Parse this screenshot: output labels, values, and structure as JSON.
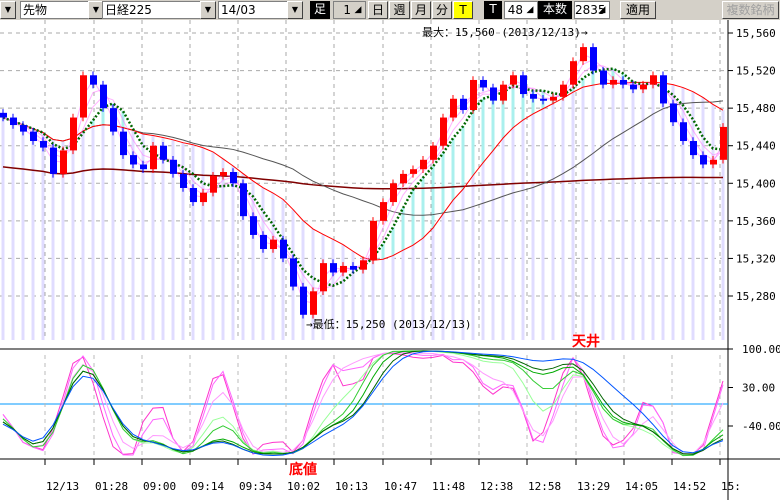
{
  "toolbar": {
    "market": "先物",
    "index": "日経225",
    "contract": "14/03",
    "bar_label": "足",
    "bar_value": "1",
    "day": "日",
    "week": "週",
    "month": "月",
    "minute": "分",
    "tick": "T",
    "t_label": "T",
    "t_value": "48",
    "count_label": "本数",
    "count_value": "2835",
    "apply": "適用",
    "multi": "複数銘柄"
  },
  "annotations": {
    "max": "最大：15,560 (2013/12/13)→",
    "min": "→最低：15,250 (2013/12/13)",
    "top": "天井",
    "bottom": "底値"
  },
  "colors": {
    "up": "#ff0000",
    "down": "#0000ff",
    "ribbon": "#ff66ff",
    "ma_green": "#006600",
    "ma_red": "#ff0000",
    "ma_gray": "#555555",
    "ma_long": "#800000",
    "zero_line": "#0099ff"
  },
  "chart_data": {
    "type": "candlestick",
    "ylim": [
      15250,
      15560
    ],
    "y_ticks": [
      "15,560",
      "15,520",
      "15,480",
      "15,440",
      "15,400",
      "15,360",
      "15,320",
      "15,280"
    ],
    "y_tick_values": [
      15560,
      15520,
      15480,
      15440,
      15400,
      15360,
      15320,
      15280
    ],
    "x_ticks": [
      "12/13",
      "01:28",
      "09:00",
      "09:14",
      "09:34",
      "10:02",
      "10:13",
      "10:47",
      "11:48",
      "12:38",
      "12:58",
      "13:29",
      "14:05",
      "14:52",
      "15:"
    ],
    "closes": [
      15470,
      15462,
      15455,
      15445,
      15438,
      15410,
      15435,
      15470,
      15515,
      15505,
      15480,
      15455,
      15430,
      15420,
      15415,
      15440,
      15425,
      15410,
      15395,
      15380,
      15390,
      15408,
      15412,
      15400,
      15365,
      15345,
      15330,
      15340,
      15320,
      15290,
      15260,
      15285,
      15315,
      15305,
      15312,
      15308,
      15318,
      15360,
      15380,
      15400,
      15410,
      15415,
      15425,
      15440,
      15470,
      15490,
      15478,
      15510,
      15502,
      15488,
      15505,
      15515,
      15495,
      15490,
      15488,
      15492,
      15505,
      15530,
      15545,
      15520,
      15505,
      15510,
      15505,
      15500,
      15505,
      15515,
      15485,
      15465,
      15445,
      15430,
      15420,
      15425,
      15460
    ],
    "oscillator": {
      "ylim": [
        -100,
        100
      ],
      "y_ticks": [
        "100.00",
        "30.00",
        "-40.00"
      ],
      "y_tick_values": [
        100,
        30,
        -40
      ]
    }
  }
}
